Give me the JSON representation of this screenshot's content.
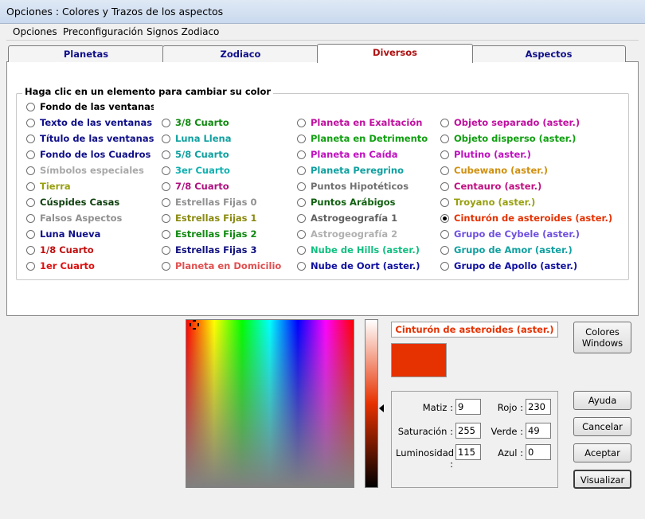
{
  "window": {
    "title": "Opciones : Colores y Trazos de los aspectos"
  },
  "menu": [
    "Opciones",
    "Preconfiguración",
    "Signos Zodiaco"
  ],
  "tabs": [
    {
      "label": "Planetas",
      "active": false
    },
    {
      "label": "Zodiaco",
      "active": false
    },
    {
      "label": "Diversos",
      "active": true
    },
    {
      "label": "Aspectos",
      "active": false
    }
  ],
  "group_title": "Haga clic en un elemento para cambiar su color",
  "background_option": {
    "label": "Fondo de las ventanas",
    "color": "#000000",
    "selected": false
  },
  "columns": [
    [
      {
        "label": "Texto de las ventanas",
        "color": "#10108a",
        "selected": false
      },
      {
        "label": "Título de las ventanas",
        "color": "#10108a",
        "selected": false
      },
      {
        "label": "Fondo de los Cuadros",
        "color": "#10108a",
        "selected": false
      },
      {
        "label": "Símbolos especiales",
        "color": "#a8a8a8",
        "selected": false
      },
      {
        "label": "Tierra",
        "color": "#98a010",
        "selected": false
      },
      {
        "label": "Cúspides Casas",
        "color": "#104010",
        "selected": false
      },
      {
        "label": "Falsos Aspectos",
        "color": "#909090",
        "selected": false
      },
      {
        "label": "Luna Nueva",
        "color": "#10108a",
        "selected": false
      },
      {
        "label": "1/8 Cuarto",
        "color": "#c01010",
        "selected": false
      },
      {
        "label": "1er Cuarto",
        "color": "#e01010",
        "selected": false
      }
    ],
    [
      {
        "label": "3/8 Cuarto",
        "color": "#108a10",
        "selected": false
      },
      {
        "label": "Luna Llena",
        "color": "#10a0a0",
        "selected": false
      },
      {
        "label": "5/8 Cuarto",
        "color": "#10a0a0",
        "selected": false
      },
      {
        "label": "3er Cuarto",
        "color": "#10b0b0",
        "selected": false
      },
      {
        "label": "7/8 Cuarto",
        "color": "#b01080",
        "selected": false
      },
      {
        "label": "Estrellas Fijas 0",
        "color": "#909090",
        "selected": false
      },
      {
        "label": "Estrellas Fijas 1",
        "color": "#8a8a10",
        "selected": false
      },
      {
        "label": "Estrellas Fijas 2",
        "color": "#108a10",
        "selected": false
      },
      {
        "label": "Estrellas Fijas 3",
        "color": "#101080",
        "selected": false
      },
      {
        "label": "Planeta en Domicilio",
        "color": "#e05050",
        "selected": false
      }
    ],
    [
      {
        "label": "Planeta en Exaltación",
        "color": "#c010a0",
        "selected": false
      },
      {
        "label": "Planeta en Detrimento",
        "color": "#10a010",
        "selected": false
      },
      {
        "label": "Planeta en Caída",
        "color": "#c010c0",
        "selected": false
      },
      {
        "label": "Planeta Peregrino",
        "color": "#10a0a0",
        "selected": false
      },
      {
        "label": "Puntos Hipotéticos",
        "color": "#707070",
        "selected": false
      },
      {
        "label": "Puntos Arábigos",
        "color": "#106010",
        "selected": false
      },
      {
        "label": "Astrogeografía 1",
        "color": "#606060",
        "selected": false
      },
      {
        "label": "Astrogeografía 2",
        "color": "#b0b0b0",
        "selected": false
      },
      {
        "label": "Nube de Hills (aster.)",
        "color": "#10c080",
        "selected": false
      },
      {
        "label": "Nube de Oort (aster.)",
        "color": "#1010a0",
        "selected": false
      }
    ],
    [
      {
        "label": "Objeto separado (aster.)",
        "color": "#c010a0",
        "selected": false
      },
      {
        "label": "Objeto disperso (aster.)",
        "color": "#10a010",
        "selected": false
      },
      {
        "label": "Plutino (aster.)",
        "color": "#c010c0",
        "selected": false
      },
      {
        "label": "Cubewano (aster.)",
        "color": "#d09010",
        "selected": false
      },
      {
        "label": "Centauro (aster.)",
        "color": "#c01080",
        "selected": false
      },
      {
        "label": "Troyano (aster.)",
        "color": "#98a010",
        "selected": false
      },
      {
        "label": "Cinturón de asteroides (aster.)",
        "color": "#e63100",
        "selected": true
      },
      {
        "label": "Grupo de Cybele (aster.)",
        "color": "#7050e0",
        "selected": false
      },
      {
        "label": "Grupo de Amor (aster.)",
        "color": "#10a0a0",
        "selected": false
      },
      {
        "label": "Grupo de Apollo (aster.)",
        "color": "#1010a0",
        "selected": false
      }
    ]
  ],
  "selected_name": "Cinturón de asteroides (aster.)",
  "selected_color": "#e63100",
  "luminosity_slider_level": 0.53,
  "values": {
    "matiz_label": "Matiz :",
    "matiz": "9",
    "saturacion_label": "Saturación :",
    "saturacion": "255",
    "luminosidad_label": "Luminosidad :",
    "luminosidad": "115",
    "rojo_label": "Rojo :",
    "rojo": "230",
    "verde_label": "Verde :",
    "verde": "49",
    "azul_label": "Azul :",
    "azul": "0"
  },
  "buttons": {
    "windows_colors_line1": "Colores",
    "windows_colors_line2": "Windows",
    "ayuda": "Ayuda",
    "cancelar": "Cancelar",
    "aceptar": "Aceptar",
    "visualizar": "Visualizar"
  }
}
